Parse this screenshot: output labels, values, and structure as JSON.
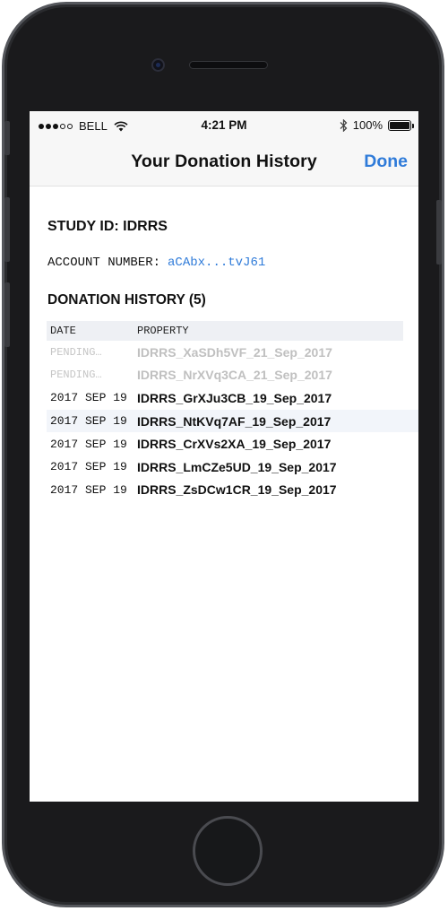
{
  "status_bar": {
    "carrier": "BELL",
    "time": "4:21 PM",
    "battery": "100%",
    "signal_bars_filled": 3,
    "signal_bars_total": 5
  },
  "nav": {
    "title": "Your Donation History",
    "done_label": "Done"
  },
  "study": {
    "study_id_label": "STUDY ID: IDRRS",
    "account_label": "ACCOUNT NUMBER:",
    "account_value": "aCAbx...tvJ61"
  },
  "history": {
    "title": "DONATION HISTORY (5)",
    "columns": {
      "date": "DATE",
      "property": "PROPERTY"
    },
    "rows": [
      {
        "date": "PENDING…",
        "property": "IDRRS_XaSDh5VF_21_Sep_2017",
        "status": "pending"
      },
      {
        "date": "PENDING…",
        "property": "IDRRS_NrXVq3CA_21_Sep_2017",
        "status": "pending"
      },
      {
        "date": "2017 SEP 19",
        "property": "IDRRS_GrXJu3CB_19_Sep_2017",
        "status": "done"
      },
      {
        "date": "2017 SEP 19",
        "property": "IDRRS_NtKVq7AF_19_Sep_2017",
        "status": "done"
      },
      {
        "date": "2017 SEP 19",
        "property": "IDRRS_CrXVs2XA_19_Sep_2017",
        "status": "done"
      },
      {
        "date": "2017 SEP 19",
        "property": "IDRRS_LmCZe5UD_19_Sep_2017",
        "status": "done"
      },
      {
        "date": "2017 SEP 19",
        "property": "IDRRS_ZsDCw1CR_19_Sep_2017",
        "status": "done"
      }
    ]
  },
  "colors": {
    "accent": "#2f7bd9",
    "pending_text": "#c0c0c0",
    "header_bg": "#eef0f4"
  },
  "icons": [
    "signal-icon",
    "wifi-icon",
    "bluetooth-icon",
    "battery-icon",
    "camera-icon",
    "home-button-icon"
  ]
}
